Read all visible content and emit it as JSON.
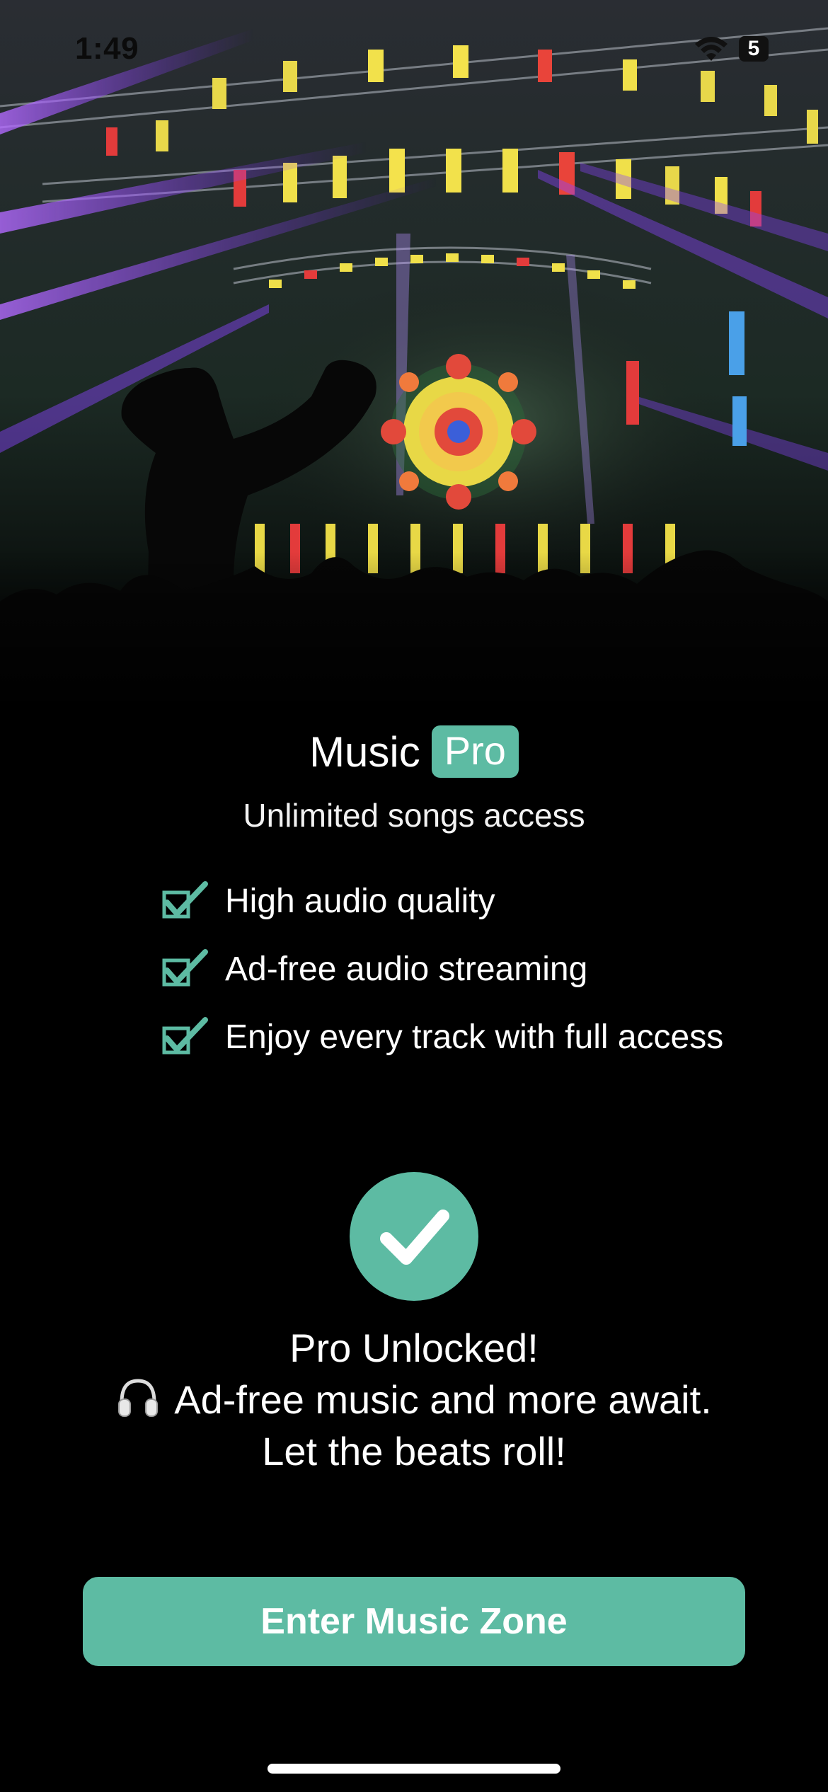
{
  "status_bar": {
    "time": "1:49",
    "battery": "5"
  },
  "header": {
    "title": "Music",
    "badge": "Pro",
    "subtitle": "Unlimited songs access"
  },
  "features": [
    {
      "label": "High audio quality"
    },
    {
      "label": "Ad-free audio streaming"
    },
    {
      "label": "Enjoy every track with full access"
    }
  ],
  "message": {
    "line1": "Pro Unlocked!",
    "line2": "Ad-free music and more await.",
    "line3": "Let the beats roll!"
  },
  "cta": {
    "label": "Enter Music Zone"
  },
  "icons": {
    "feature_check": "check-mark-icon",
    "success": "check-circle-icon",
    "inline": "headphones-icon"
  },
  "colors": {
    "accent": "#5dbba3",
    "background": "#000000"
  }
}
